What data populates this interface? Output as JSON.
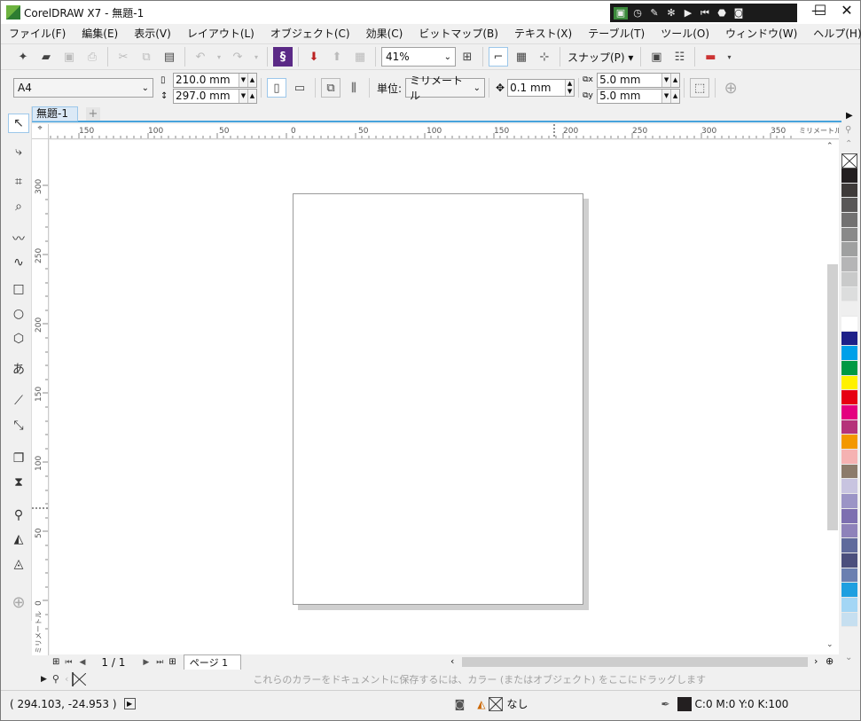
{
  "window": {
    "title": "CorelDRAW X7 - 無題-1"
  },
  "menu": [
    "ファイル(F)",
    "編集(E)",
    "表示(V)",
    "レイアウト(L)",
    "オブジェクト(C)",
    "効果(C)",
    "ビットマップ(B)",
    "テキスト(X)",
    "テーブル(T)",
    "ツール(O)",
    "ウィンドウ(W)",
    "ヘルプ(H)"
  ],
  "toolbar": {
    "zoom": "41%",
    "snap": "スナップ(P)"
  },
  "property": {
    "paper": "A4",
    "width": "210.0 mm",
    "height": "297.0 mm",
    "units_label": "単位:",
    "units": "ミリメートル",
    "nudge": "0.1 mm",
    "dup_x": "5.0 mm",
    "dup_y": "5.0 mm"
  },
  "tabs": {
    "document": "無題-1",
    "add": "+"
  },
  "ruler": {
    "h_ticks": [
      "150",
      "100",
      "50",
      "0",
      "50",
      "100",
      "150",
      "200",
      "250",
      "300",
      "350"
    ],
    "v_ticks": [
      "300",
      "250",
      "200",
      "150",
      "100",
      "50",
      "0"
    ],
    "unit": "ミリメートル"
  },
  "pagenav": {
    "counter": "1 / 1",
    "page_tab": "ページ 1"
  },
  "docpalette": {
    "hint": "これらのカラーをドキュメントに保存するには、カラー (またはオブジェクト) をここにドラッグします"
  },
  "status": {
    "coords": "( 294.103, -24.953 )",
    "fill": "なし",
    "outline_color_text": "C:0 M:0 Y:0 K:100"
  },
  "palette": [
    "#231f20",
    "#3e3a39",
    "#595757",
    "#727171",
    "#898989",
    "#9fa0a0",
    "#b5b5b6",
    "#c9caca",
    "#dcdddd",
    "#efefef",
    "#ffffff",
    "#1d2088",
    "#00a0e9",
    "#009944",
    "#fff100",
    "#e60012",
    "#e4007f",
    "#b5337a",
    "#f39800",
    "#f5b2b2",
    "#8c7b6b",
    "#c8c4e0",
    "#9b94c6",
    "#7d6fb0",
    "#8e82ba",
    "#5f6a9c",
    "#4b4f7d",
    "#6a7fb0",
    "#1e9fe0",
    "#a3d6f5",
    "#c6dff0"
  ],
  "colors": {
    "accent": "#47a3dc",
    "page_shadow": "#cfcfcf"
  }
}
